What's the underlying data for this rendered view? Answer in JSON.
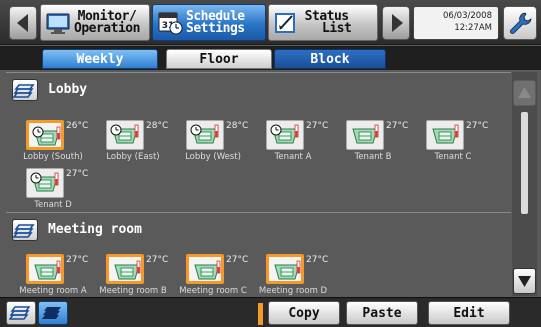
{
  "topbar": {
    "monitor_label_1": "Monitor/",
    "monitor_label_2": "Operation",
    "schedule_label_1": "Schedule",
    "schedule_label_2": "Settings",
    "schedule_icon_day": "31",
    "status_label_1": "Status",
    "status_label_2": "List",
    "date": "06/03/2008",
    "time": "12:27AM"
  },
  "tabs": [
    "Weekly",
    "Floor",
    "Block"
  ],
  "groups": [
    {
      "name": "Lobby",
      "units": [
        {
          "name": "Lobby (South)",
          "temp": "26°C",
          "selected": true,
          "schedule": true
        },
        {
          "name": "Lobby (East)",
          "temp": "28°C",
          "selected": false,
          "schedule": true
        },
        {
          "name": "Lobby (West)",
          "temp": "28°C",
          "selected": false,
          "schedule": true
        },
        {
          "name": "Tenant A",
          "temp": "27°C",
          "selected": false,
          "schedule": true
        },
        {
          "name": "Tenant B",
          "temp": "27°C",
          "selected": false,
          "schedule": false
        },
        {
          "name": "Tenant C",
          "temp": "27°C",
          "selected": false,
          "schedule": false
        },
        {
          "name": "Tenant D",
          "temp": "27°C",
          "selected": false,
          "schedule": true
        }
      ]
    },
    {
      "name": "Meeting room",
      "units": [
        {
          "name": "Meeting room A",
          "temp": "27°C",
          "selected": true,
          "schedule": false
        },
        {
          "name": "Meeting room B",
          "temp": "27°C",
          "selected": true,
          "schedule": false
        },
        {
          "name": "Meeting room C",
          "temp": "27°C",
          "selected": true,
          "schedule": false
        },
        {
          "name": "Meeting room D",
          "temp": "27°C",
          "selected": true,
          "schedule": false
        }
      ]
    }
  ],
  "bottombar": {
    "copy": "Copy",
    "paste": "Paste",
    "edit": "Edit"
  },
  "colors": {
    "accent_blue": "#2f7fd2",
    "selection_orange": "#f39a28",
    "unit_green": "#8fd6a8",
    "setpoint_red": "#d83a3a"
  },
  "icons": [
    "prev-arrow-icon",
    "monitor-icon",
    "calendar-icon",
    "status-list-icon",
    "next-arrow-icon",
    "wrench-icon",
    "group-icon",
    "scroll-up-icon",
    "scroll-down-icon",
    "list-view-icon",
    "stack-view-icon"
  ]
}
